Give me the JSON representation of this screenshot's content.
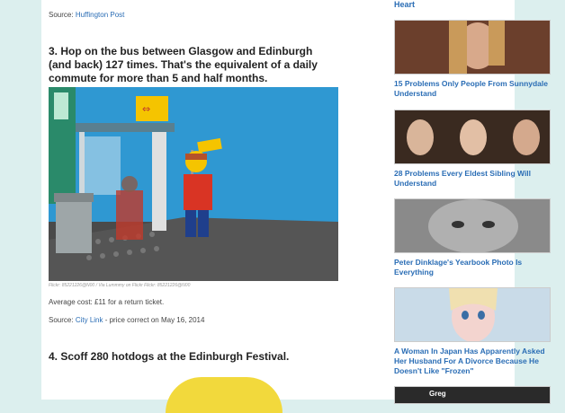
{
  "article": {
    "source1": {
      "label": "Source:",
      "link": "Huffington Post"
    },
    "item3": {
      "headline": "3. Hop on the bus between Glasgow and Edinburgh (and back) 127 times. That's the equivalent of a daily commute for more than 5 and half months.",
      "photo_credit": "Flickr: 85221226@N00 / Via Lummmy on Flickr Flickr: 85221226@N00",
      "cost": "Average cost: £11 for a return ticket.",
      "source_label": "Source:",
      "source_link": "City Link",
      "source_suffix": " - price correct on May 16, 2014"
    },
    "item4": {
      "headline": "4. Scoff 280 hotdogs at the Edinburgh Festival."
    }
  },
  "sidebar": {
    "top_link": "Heart",
    "cards": [
      {
        "title": "15 Problems Only People From Sunnydale Understand",
        "thumb": "sunnydale-photo"
      },
      {
        "title": "28 Problems Every Eldest Sibling Will Understand",
        "thumb": "eldest-sibling-photo"
      },
      {
        "title": "Peter Dinklage's Yearbook Photo Is Everything",
        "thumb": "yearbook-photo"
      },
      {
        "title": "A Woman In Japan Has Apparently Asked Her Husband For A Divorce Because He Doesn't Like \"Frozen\"",
        "thumb": "frozen-elsa-photo"
      },
      {
        "title": "",
        "thumb_text": "Greg",
        "thumb": "greg-photo"
      }
    ]
  },
  "colors": {
    "link": "#2a6db5",
    "background": "#dcefee"
  }
}
